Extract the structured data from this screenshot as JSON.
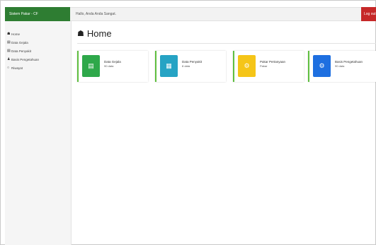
{
  "header": {
    "brand": "Sistem Pakar - CF",
    "greeting": "Hallo, Anda Anda Sangat.",
    "logout": "Log out"
  },
  "sidebar": {
    "items": [
      {
        "icon": "home-icon",
        "label": "Home"
      },
      {
        "icon": "list-icon",
        "label": "Data Gejala"
      },
      {
        "icon": "list-icon",
        "label": "Data Penyakit"
      },
      {
        "icon": "person-icon",
        "label": "Basis Pengetahuan"
      },
      {
        "icon": "circle-icon",
        "label": "Riwayat"
      }
    ]
  },
  "main": {
    "title": "Home",
    "cards": [
      {
        "label": "Data Gejala",
        "value": "90 data",
        "color": "#2ea84a",
        "icon": "document-icon"
      },
      {
        "label": "Data Penyakit",
        "value": "8 data",
        "color": "#26a3c4",
        "icon": "clipboard-icon"
      },
      {
        "label": "Pakar Pertanyaan",
        "value": "Pakar",
        "color": "#f5c518",
        "icon": "gear-icon"
      },
      {
        "label": "Basis Pengetahuan",
        "value": "90 data",
        "color": "#1e6fe0",
        "icon": "cog-icon"
      }
    ]
  }
}
